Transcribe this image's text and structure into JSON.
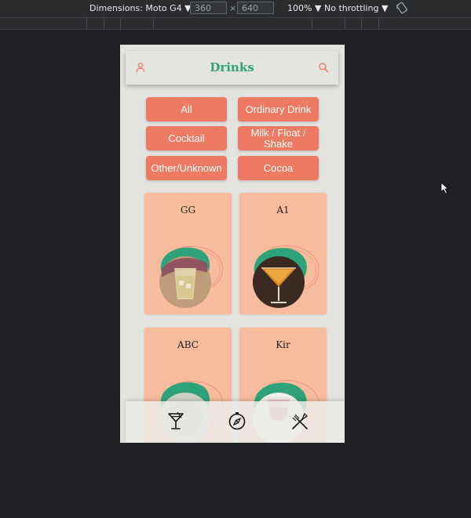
{
  "devtools": {
    "device_label": "Dimensions: Moto G4 ▼",
    "width": "360",
    "times": "×",
    "height": "640",
    "zoom": "100% ▼",
    "throttle": "No throttling ▼"
  },
  "app": {
    "title": "Drinks",
    "accent_color": "#2ea27a",
    "button_color": "#ef7a63",
    "card_color": "#f7bc9d"
  },
  "categories": [
    {
      "label": "All"
    },
    {
      "label": "Ordinary Drink"
    },
    {
      "label": "Cocktail"
    },
    {
      "label": "Milk / Float / Shake"
    },
    {
      "label": "Other/Unknown"
    },
    {
      "label": "Cocoa"
    }
  ],
  "drinks": [
    {
      "name": "GG"
    },
    {
      "name": "A1"
    },
    {
      "name": "ABC"
    },
    {
      "name": "Kir"
    }
  ],
  "bottom_nav": [
    {
      "icon": "cocktail-icon"
    },
    {
      "icon": "compass-icon"
    },
    {
      "icon": "utensils-icon"
    }
  ]
}
